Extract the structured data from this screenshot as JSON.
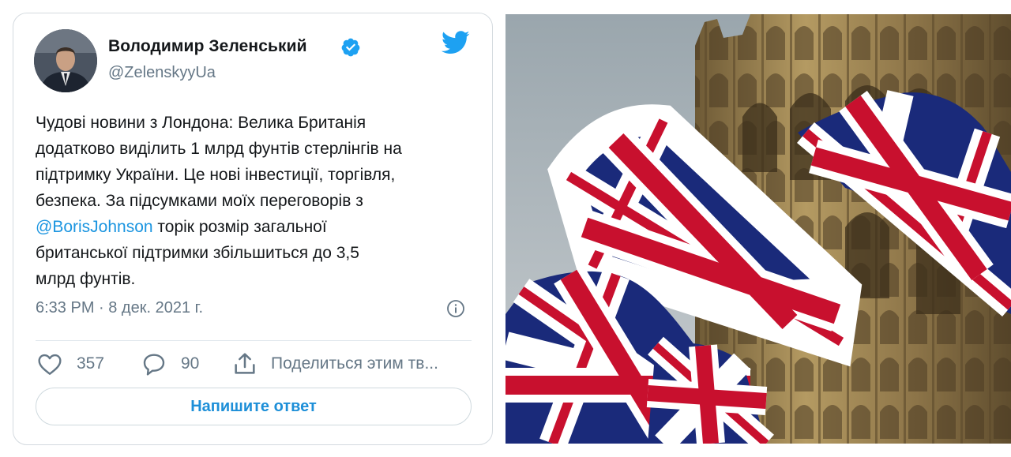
{
  "tweet": {
    "author_name": "Володимир Зеленський",
    "author_handle": "@ZelenskyyUa",
    "text_lines": [
      "Чудові новини з Лондона: Велика Британія",
      "додатково виділить 1 млрд фунтів стерлінгів на",
      "підтримку України. Це нові інвестиції, торгівля,",
      "безпека. За підсумками моїх переговорів з"
    ],
    "mention": "@BorisJohnson",
    "text_after_mention": " торік розмір загальної",
    "text_lines_after": [
      "британської підтримки збільшиться до 3,5",
      "млрд фунтів."
    ],
    "timestamp": "6:33 PM · 8 дек. 2021 г.",
    "likes": "357",
    "replies": "90",
    "share_label": "Поделиться этим тв...",
    "reply_button_label": "Напишите ответ"
  },
  "icons": {
    "verified": "verified-badge-icon",
    "brand": "twitter-bird-icon",
    "info": "info-icon",
    "like": "heart-icon",
    "reply": "comment-icon",
    "share": "share-icon"
  },
  "colors": {
    "link": "#1b95e0",
    "twitter_blue": "#1da1f2",
    "secondary_text": "#657786",
    "flag_blue": "#1a2a7a",
    "flag_red": "#c8102e"
  }
}
